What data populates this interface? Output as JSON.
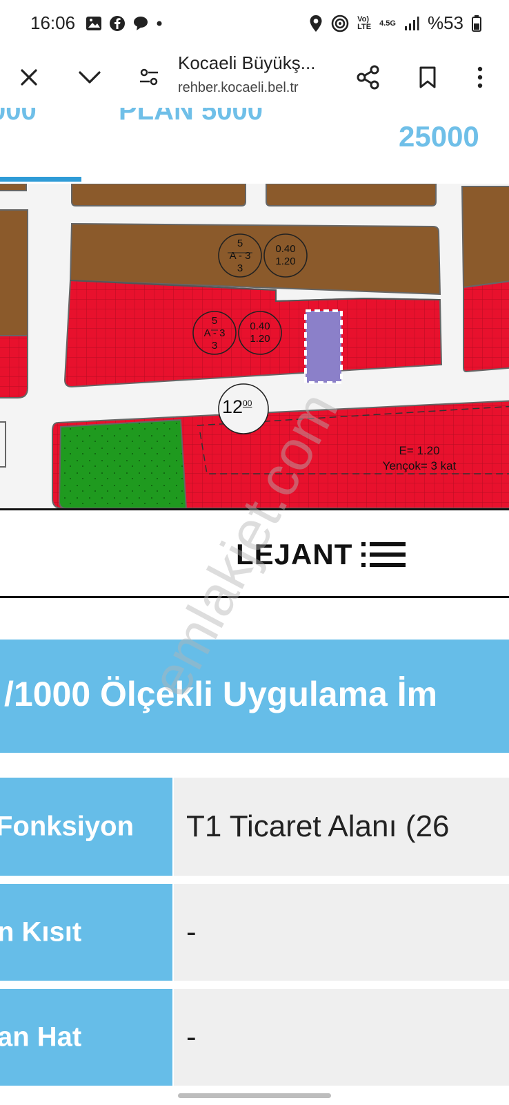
{
  "status_bar": {
    "time": "16:06",
    "battery_text": "%53",
    "network_label_top": "Vo)",
    "network_label_bottom": "LTE",
    "network_gen": "4.5G"
  },
  "browser": {
    "page_title": "Kocaeli Büyükş...",
    "url": "rehber.kocaeli.bel.tr"
  },
  "tabs": [
    {
      "label": "000"
    },
    {
      "label": "PLAN 5000"
    },
    {
      "label": "25000"
    }
  ],
  "map": {
    "zone_upper": {
      "density": "5",
      "code": "A - 3",
      "floors": "3",
      "ratio_top": "0.40",
      "ratio_bottom": "1.20"
    },
    "zone_lower": {
      "density": "5",
      "code": "A - 3",
      "floors": "3",
      "ratio_top": "0.40",
      "ratio_bottom": "1.20"
    },
    "road_width": "12",
    "road_width_sup": "00",
    "parcel_e": "E= 1.20",
    "parcel_yencok": "Yençok= 3 kat",
    "colors": {
      "residential": "#8b5a2b",
      "commercial": "#e8112d",
      "green": "#1f9a1f",
      "selected": "#8b80c9",
      "road": "#f4f4f4"
    }
  },
  "legend": {
    "label": "LEJANT"
  },
  "info": {
    "title": "/1000 Ölçekli Uygulama İm",
    "rows": [
      {
        "key": "Fonksiyon",
        "value": "T1 Ticaret Alanı (26"
      },
      {
        "key": "n Kısıt",
        "value": "-"
      },
      {
        "key": "an Hat",
        "value": "-"
      }
    ]
  },
  "watermark": "emlakjet.com",
  "accent_color": "#66bde8"
}
